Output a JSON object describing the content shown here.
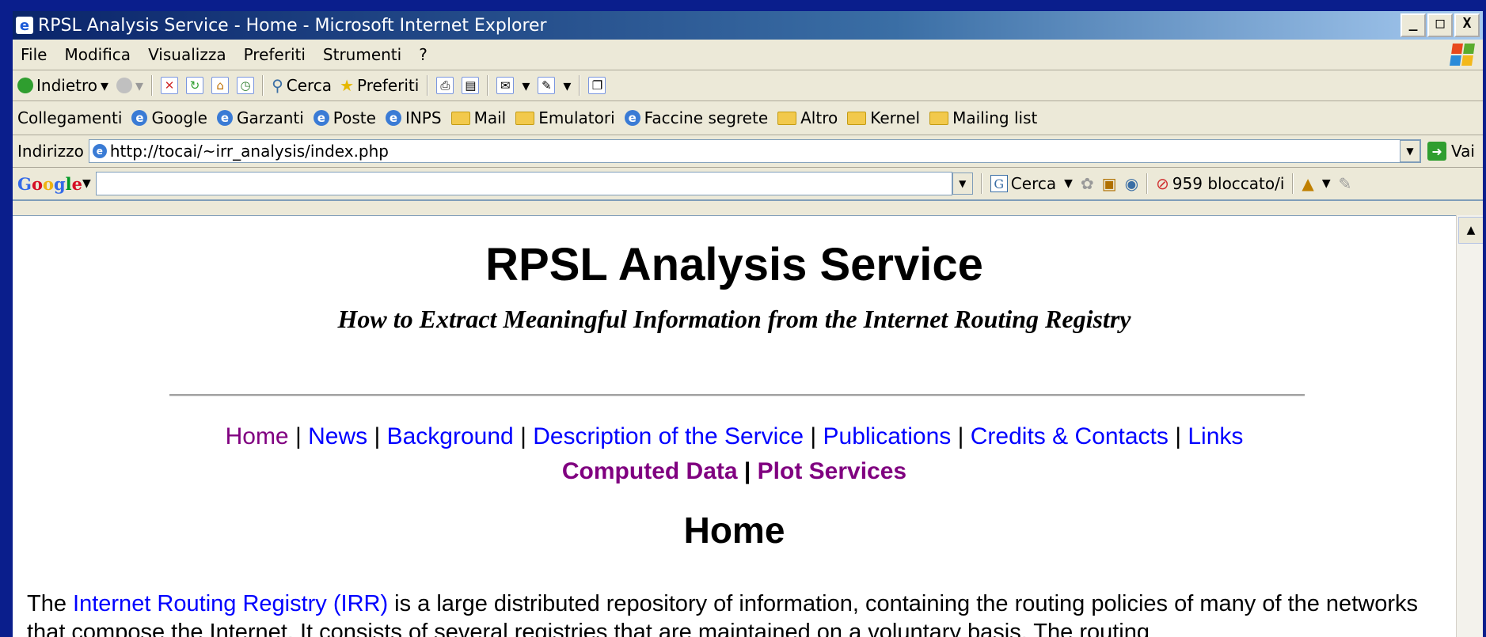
{
  "window": {
    "title": "RPSL Analysis Service - Home - Microsoft Internet Explorer",
    "controls": [
      "_",
      "□",
      "X"
    ]
  },
  "menu": {
    "items": [
      "File",
      "Modifica",
      "Visualizza",
      "Preferiti",
      "Strumenti",
      "?"
    ]
  },
  "toolbar": {
    "back_label": "Indietro",
    "search_label": "Cerca",
    "favorites_label": "Preferiti"
  },
  "links_bar": {
    "label": "Collegamenti",
    "items": [
      {
        "label": "Google",
        "icon": "ie-page-icon"
      },
      {
        "label": "Garzanti",
        "icon": "ie-page-icon"
      },
      {
        "label": "Poste",
        "icon": "ie-page-icon"
      },
      {
        "label": "INPS",
        "icon": "ie-page-icon"
      },
      {
        "label": "Mail",
        "icon": "folder-icon"
      },
      {
        "label": "Emulatori",
        "icon": "folder-icon"
      },
      {
        "label": "Faccine segrete",
        "icon": "ie-page-icon"
      },
      {
        "label": "Altro",
        "icon": "folder-icon"
      },
      {
        "label": "Kernel",
        "icon": "folder-icon"
      },
      {
        "label": "Mailing list",
        "icon": "folder-icon"
      }
    ]
  },
  "address": {
    "label": "Indirizzo",
    "url": "http://tocai/~irr_analysis/index.php",
    "go_label": "Vai"
  },
  "google_toolbar": {
    "logo": "Google",
    "search_label": "Cerca",
    "blocked_label": "959 bloccato/i"
  },
  "page": {
    "title": "RPSL Analysis Service",
    "subtitle": "How to Extract Meaningful Information from the Internet Routing Registry",
    "nav_primary": [
      "Home",
      "News",
      "Background",
      "Description of the Service",
      "Publications",
      "Credits & Contacts",
      "Links"
    ],
    "nav_secondary": [
      "Computed Data",
      "Plot Services"
    ],
    "separator": "|",
    "section_heading": "Home",
    "intro_before_link": "The ",
    "intro_link": "Internet Routing Registry (IRR)",
    "intro_after_link": " is a large distributed repository of information, containing the routing policies of many of the networks that compose the Internet. It consists of several registries that are maintained on a voluntary basis. The routing"
  },
  "colors": {
    "link": "#0000ff",
    "visited_link": "#800080",
    "desktop_background": "#0a1e8c",
    "title_bar": "#0a246a"
  }
}
